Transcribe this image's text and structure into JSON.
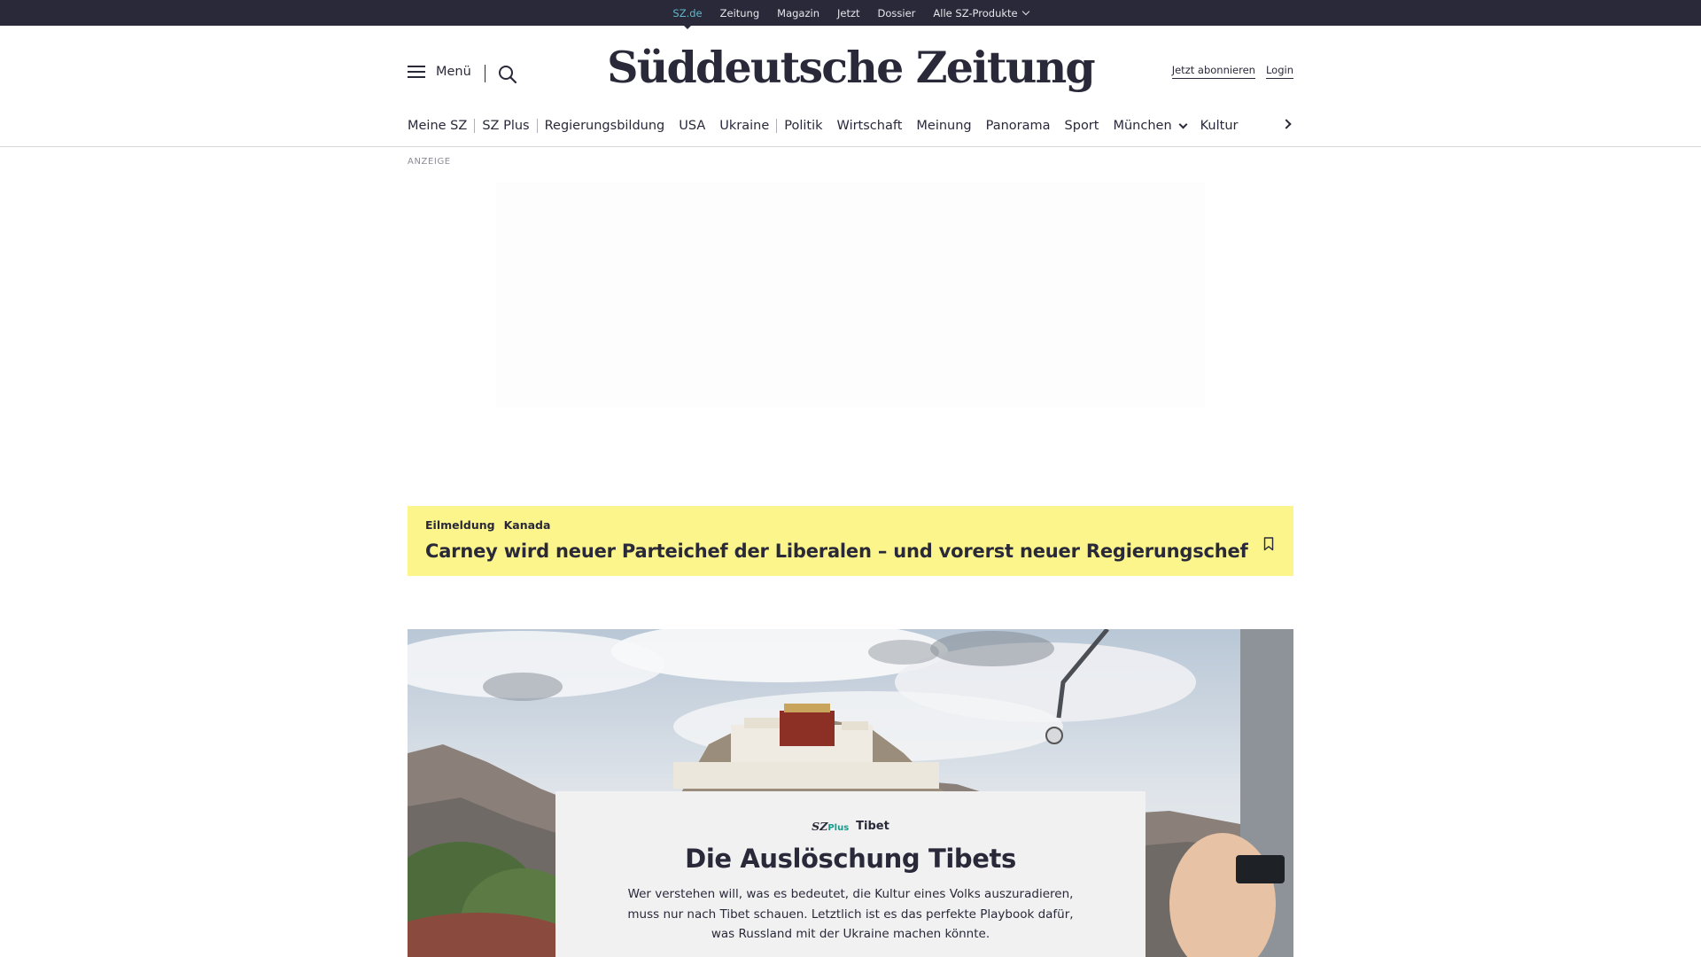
{
  "topbar": {
    "links": [
      {
        "label": "SZ.de",
        "active": true
      },
      {
        "label": "Zeitung"
      },
      {
        "label": "Magazin"
      },
      {
        "label": "Jetzt"
      },
      {
        "label": "Dossier"
      },
      {
        "label": "Alle SZ-Produkte"
      }
    ]
  },
  "header": {
    "menu_label": "Menü",
    "logo": "Süddeutsche Zeitung",
    "subscribe_label": "Jetzt abonnieren",
    "login_label": "Login"
  },
  "secnav": {
    "items": [
      "Meine SZ",
      "SZ Plus",
      "Regierungsbildung",
      "USA",
      "Ukraine",
      "Politik",
      "Wirtschaft",
      "Meinung",
      "Panorama",
      "Sport",
      "München",
      "Kultur"
    ]
  },
  "ad": {
    "label": "ANZEIGE"
  },
  "breaking": {
    "tag": "Eilmeldung",
    "topic": "Kanada",
    "headline": "Carney wird neuer Parteichef der Liberalen – und vorerst neuer Regierungschef"
  },
  "hero": {
    "brand": "SZ",
    "brand_suffix": "Plus",
    "topic": "Tibet",
    "title": "Die Auslöschung Tibets",
    "text": "Wer verstehen will, was es bedeutet, die Kultur eines Volks auszuradieren, muss nur nach Tibet schauen. Letztlich ist es das perfekte Playbook dafür, was Russland mit der Ukraine machen könnte."
  },
  "colors": {
    "dark": "#29293a",
    "accent": "#5fb8ca",
    "breaking_bg": "#fbf58b",
    "plus_green": "#1a9a8a"
  }
}
